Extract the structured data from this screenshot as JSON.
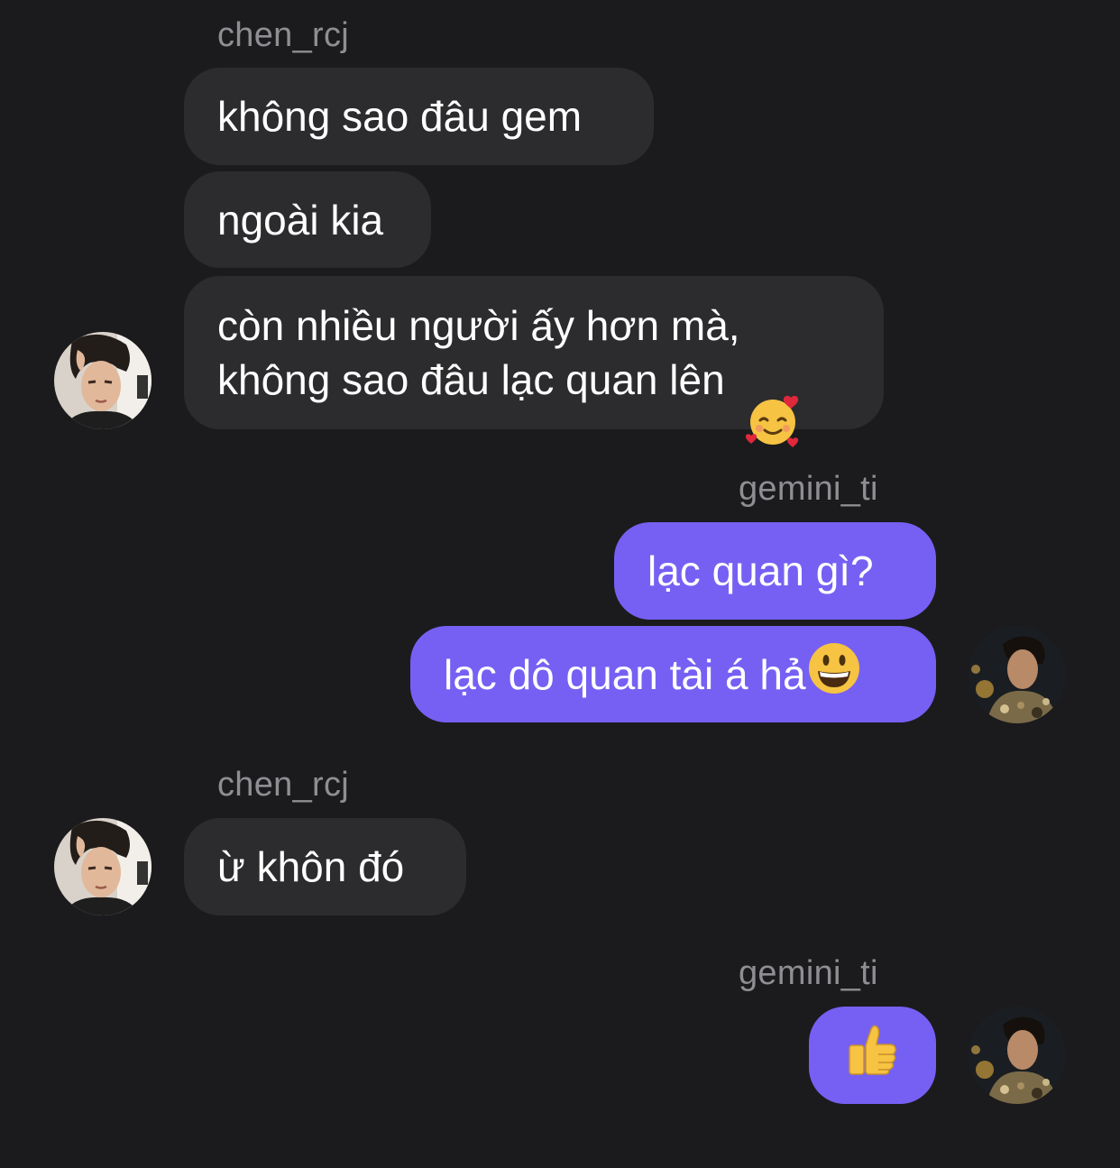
{
  "colors": {
    "background": "#1b1b1d",
    "incoming_bubble": "#2c2c2e",
    "outgoing_bubble": "#7660f3",
    "username": "#8e8e93",
    "text": "#ffffff"
  },
  "messages": {
    "group1": {
      "username": "chen_rcj",
      "lines": [
        "không sao đâu gem",
        "ngoài kia",
        "còn nhiều người ấy hơn mà,\nkhông sao đâu lạc quan lên"
      ],
      "emoji_icon": "smiling-face-with-hearts-icon"
    },
    "group2": {
      "username": "gemini_ti",
      "lines": [
        "lạc quan gì?",
        "lạc dô quan tài á hả"
      ],
      "emoji_icon": "grinning-face-icon"
    },
    "group3": {
      "username": "chen_rcj",
      "lines": [
        "ừ khôn đó"
      ]
    },
    "group4": {
      "username": "gemini_ti",
      "emoji_icon": "thumbs-up-icon"
    }
  }
}
